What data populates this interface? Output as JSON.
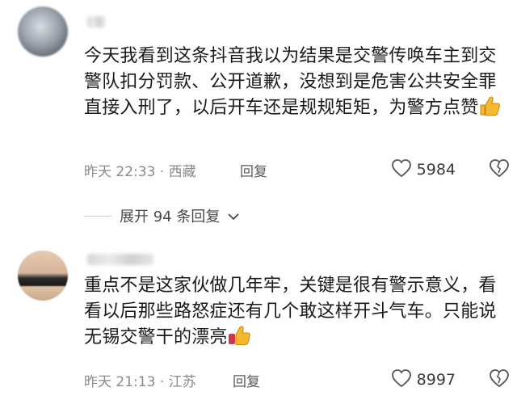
{
  "comments": [
    {
      "text": "今天我看到这条抖音我以为结果是交警传唤车主到交警队扣分罚款、公开道歉，没想到是危害公共安全罪直接入刑了，以后开车还是规规矩矩，为警方点赞",
      "emoji": "thumbs-up",
      "time": "昨天 22:33",
      "location": "西藏",
      "reply_label": "回复",
      "likes": "5984"
    },
    {
      "text": "重点不是这家伙做几年牢，关键是很有警示意义，看看以后那些路怒症还有几个敢这样开斗气车。只能说无锡交警干的漂亮",
      "emoji": "thumbs-up",
      "time": "昨天 21:13",
      "location": "江苏",
      "reply_label": "回复",
      "likes": "8997"
    }
  ],
  "expand": {
    "label": "展开 94 条回复"
  },
  "colors": {
    "thumb": "#f5b82e",
    "text": "#1a1a1a",
    "meta": "#8a8a8a"
  },
  "icons": [
    "heart-outline-icon",
    "dislike-heart-icon",
    "chevron-down-icon",
    "thumbs-up-emoji"
  ]
}
